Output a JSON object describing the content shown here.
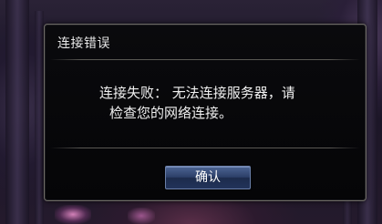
{
  "dialog": {
    "title": "连接错误",
    "message_line1": "连接失败： 无法连接服务器，请",
    "message_line2": "检查您的网络连接。",
    "confirm_label": "确认"
  },
  "colors": {
    "dialog_background": "#050507",
    "dialog_border": "#6e6b66",
    "button_top": "#4d6594",
    "button_bottom": "#22335a",
    "text": "#f0f0f0"
  }
}
